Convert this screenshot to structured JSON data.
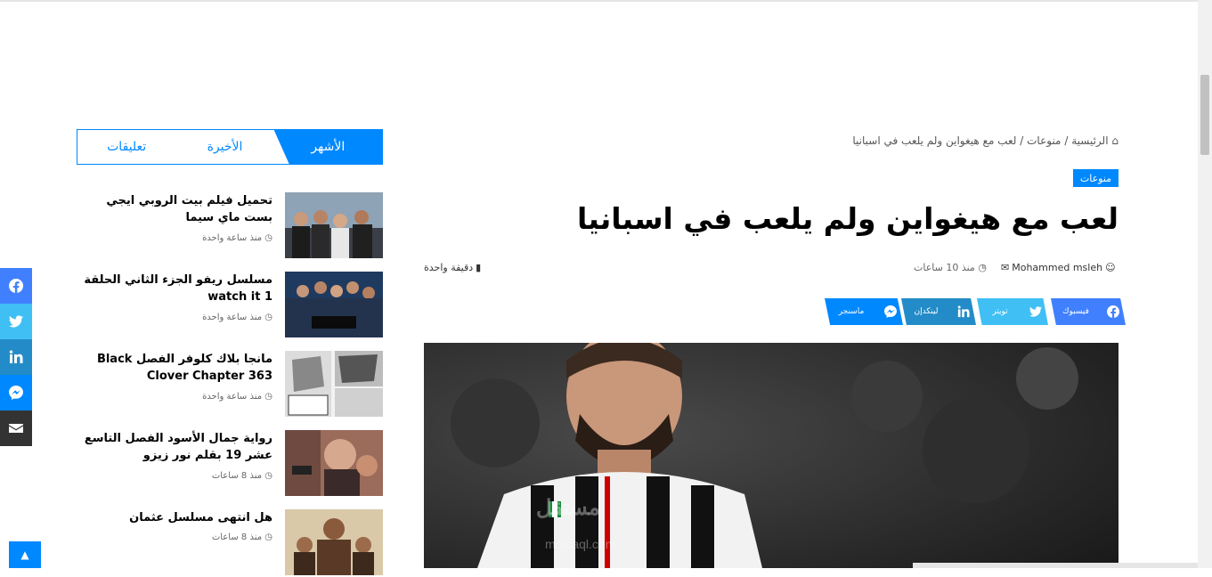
{
  "colors": {
    "accent": "#0088ff",
    "facebook": "#4080ff",
    "twitter": "#40bff5",
    "linkedin": "#238cc8",
    "messenger": "#0088ff",
    "email": "#333333"
  },
  "breadcrumb": {
    "home": "الرئيسية",
    "sep": "/",
    "category": "منوعات",
    "current": "لعب مع هيغواين ولم يلعب في اسبانيا"
  },
  "article": {
    "category": "منوعات",
    "title": "لعب مع هيغواين ولم يلعب في اسبانيا",
    "author": "Mohammed msleh",
    "time": "منذ 10 ساعات",
    "read_time": "دقيقة واحدة",
    "watermark": "مستقل",
    "watermark_url": "mostaql.com"
  },
  "share_buttons": [
    {
      "label": "فيسبوك",
      "icon": "facebook-icon"
    },
    {
      "label": "تويتر",
      "icon": "twitter-icon"
    },
    {
      "label": "لينكدإن",
      "icon": "linkedin-icon"
    },
    {
      "label": "ماسنجر",
      "icon": "messenger-icon"
    }
  ],
  "sidebar": {
    "tabs": [
      "الأشهر",
      "الأخيرة",
      "تعليقات"
    ],
    "posts": [
      {
        "title": "تحميل فيلم بيت الروبي ايجي بست ماي سيما",
        "date": "منذ ساعة واحدة"
      },
      {
        "title": "مسلسل ريفو الجزء الثاني الحلقة 1 watch it",
        "date": "منذ ساعة واحدة"
      },
      {
        "title": "مانجا بلاك كلوفر الفصل Black Clover Chapter 363",
        "date": "منذ ساعة واحدة"
      },
      {
        "title": "رواية جمال الأسود الفصل التاسع عشر 19 بقلم نور زيزو",
        "date": "منذ 8 ساعات"
      },
      {
        "title": "هل انتهى مسلسل عثمان",
        "date": "منذ 8 ساعات"
      }
    ]
  }
}
